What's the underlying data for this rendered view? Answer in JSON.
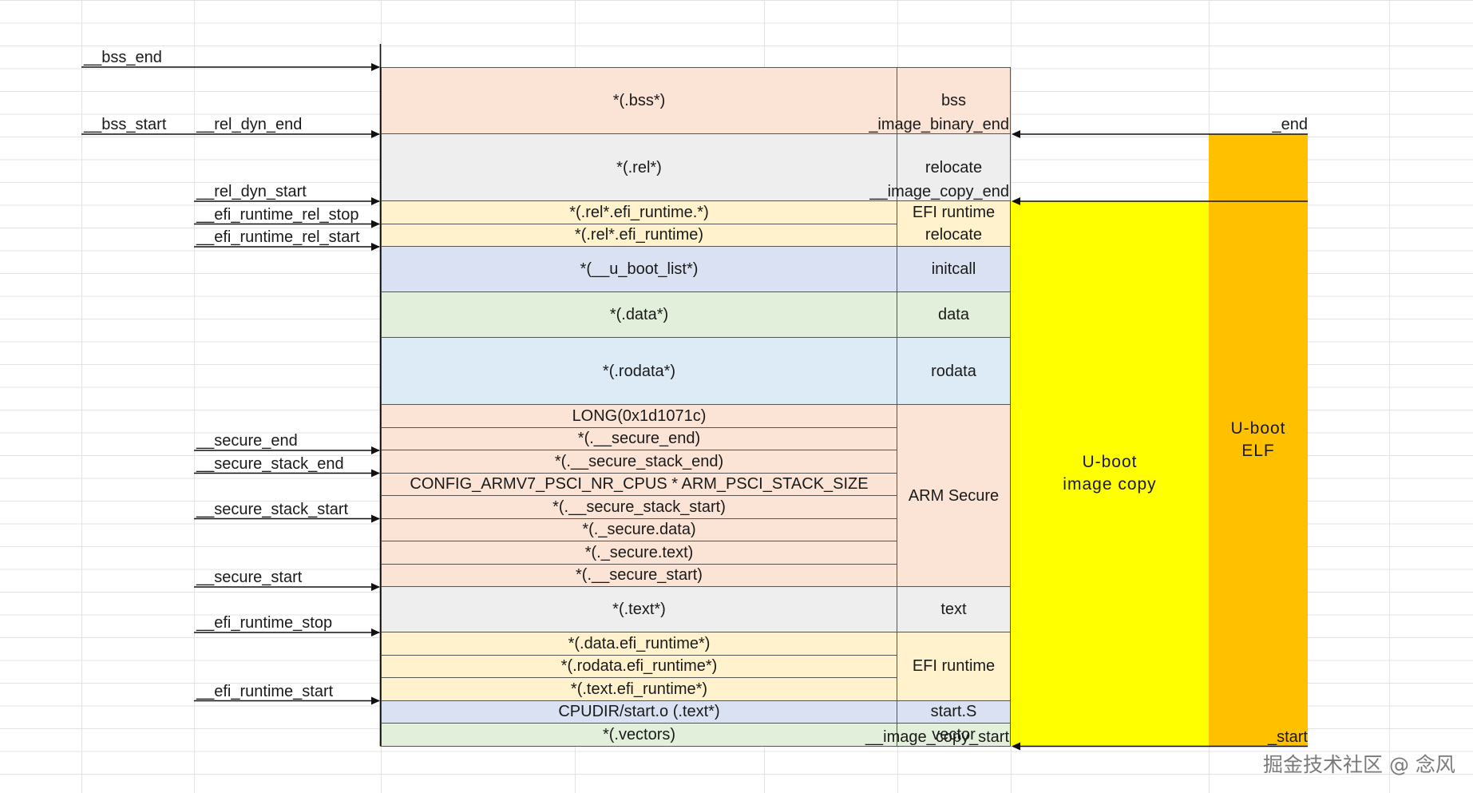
{
  "colors": {
    "peach": "#fbe4d6",
    "gray": "#eeeeee",
    "cream": "#fff2cc",
    "lavender": "#d9e1f2",
    "green": "#e2efda",
    "lightblue": "#ddebf7",
    "yellow": "#ffff00",
    "orange": "#ffc000"
  },
  "sections": [
    {
      "label": "bss",
      "color": "peach",
      "rows": [
        "*(.bss*)"
      ]
    },
    {
      "label": "relocate",
      "color": "gray",
      "rows": [
        "*(.rel*)"
      ]
    },
    {
      "label": "EFI runtime\nrelocate",
      "color": "cream",
      "rows": [
        "*(.rel*.efi_runtime.*)",
        "*(.rel*.efi_runtime)"
      ]
    },
    {
      "label": "initcall",
      "color": "lavender",
      "rows": [
        "*(__u_boot_list*)"
      ]
    },
    {
      "label": "data",
      "color": "green",
      "rows": [
        "*(.data*)"
      ]
    },
    {
      "label": "rodata",
      "color": "lightblue",
      "rows": [
        "*(.rodata*)"
      ]
    },
    {
      "label": "ARM Secure",
      "color": "peach",
      "rows": [
        "LONG(0x1d1071c)",
        "*(.__secure_end)",
        "*(.__secure_stack_end)",
        "CONFIG_ARMV7_PSCI_NR_CPUS * ARM_PSCI_STACK_SIZE",
        "*(.__secure_stack_start)",
        "*(._secure.data)",
        "*(._secure.text)",
        "*(.__secure_start)"
      ]
    },
    {
      "label": "text",
      "color": "gray",
      "rows": [
        "*(.text*)"
      ]
    },
    {
      "label": "EFI runtime",
      "color": "cream",
      "rows": [
        "*(.data.efi_runtime*)",
        "*(.rodata.efi_runtime*)",
        "*(.text.efi_runtime*)"
      ]
    },
    {
      "label": "start.S",
      "color": "lavender",
      "rows": [
        "CPUDIR/start.o (.text*)"
      ]
    },
    {
      "label": "vector",
      "color": "green",
      "rows": [
        "*(.vectors)"
      ]
    }
  ],
  "left_symbols": [
    {
      "col": 0,
      "arrow": "__bss_end",
      "text": "__bss_end"
    },
    {
      "col": 0,
      "arrow": "__bss_start",
      "text": "__bss_start"
    },
    {
      "col": 1,
      "arrow": "__bss_start",
      "text": "__rel_dyn_end"
    },
    {
      "col": 1,
      "arrow": "__rel_dyn_start",
      "text": "__rel_dyn_start"
    },
    {
      "col": 1,
      "arrow": "__efi_runtime_rel_stop",
      "text": "__efi_runtime_rel_stop"
    },
    {
      "col": 1,
      "arrow": "__efi_runtime_rel_start",
      "text": "__efi_runtime_rel_start"
    },
    {
      "col": 1,
      "arrow": "__secure_end",
      "text": "__secure_end"
    },
    {
      "col": 1,
      "arrow": "__secure_stack_end",
      "text": "__secure_stack_end"
    },
    {
      "col": 1,
      "arrow": "__secure_stack_start",
      "text": "__secure_stack_start"
    },
    {
      "col": 1,
      "arrow": "__secure_start",
      "text": "__secure_start"
    },
    {
      "col": 1,
      "arrow": "__efi_runtime_stop",
      "text": "__efi_runtime_stop"
    },
    {
      "col": 1,
      "arrow": "__efi_runtime_start",
      "text": "__efi_runtime_start"
    }
  ],
  "right_symbols": [
    {
      "col": 0,
      "text": "_image_binary_end"
    },
    {
      "col": 1,
      "text": "_end"
    },
    {
      "col": 0,
      "text": "__image_copy_end"
    },
    {
      "col": 0,
      "text": "__image_copy_start"
    },
    {
      "col": 1,
      "text": "_start"
    }
  ],
  "copy_block": {
    "label": "U-boot\nimage copy"
  },
  "elf_block": {
    "label": "U-boot\nELF"
  },
  "watermark": "掘金技术社区 @ 念风"
}
